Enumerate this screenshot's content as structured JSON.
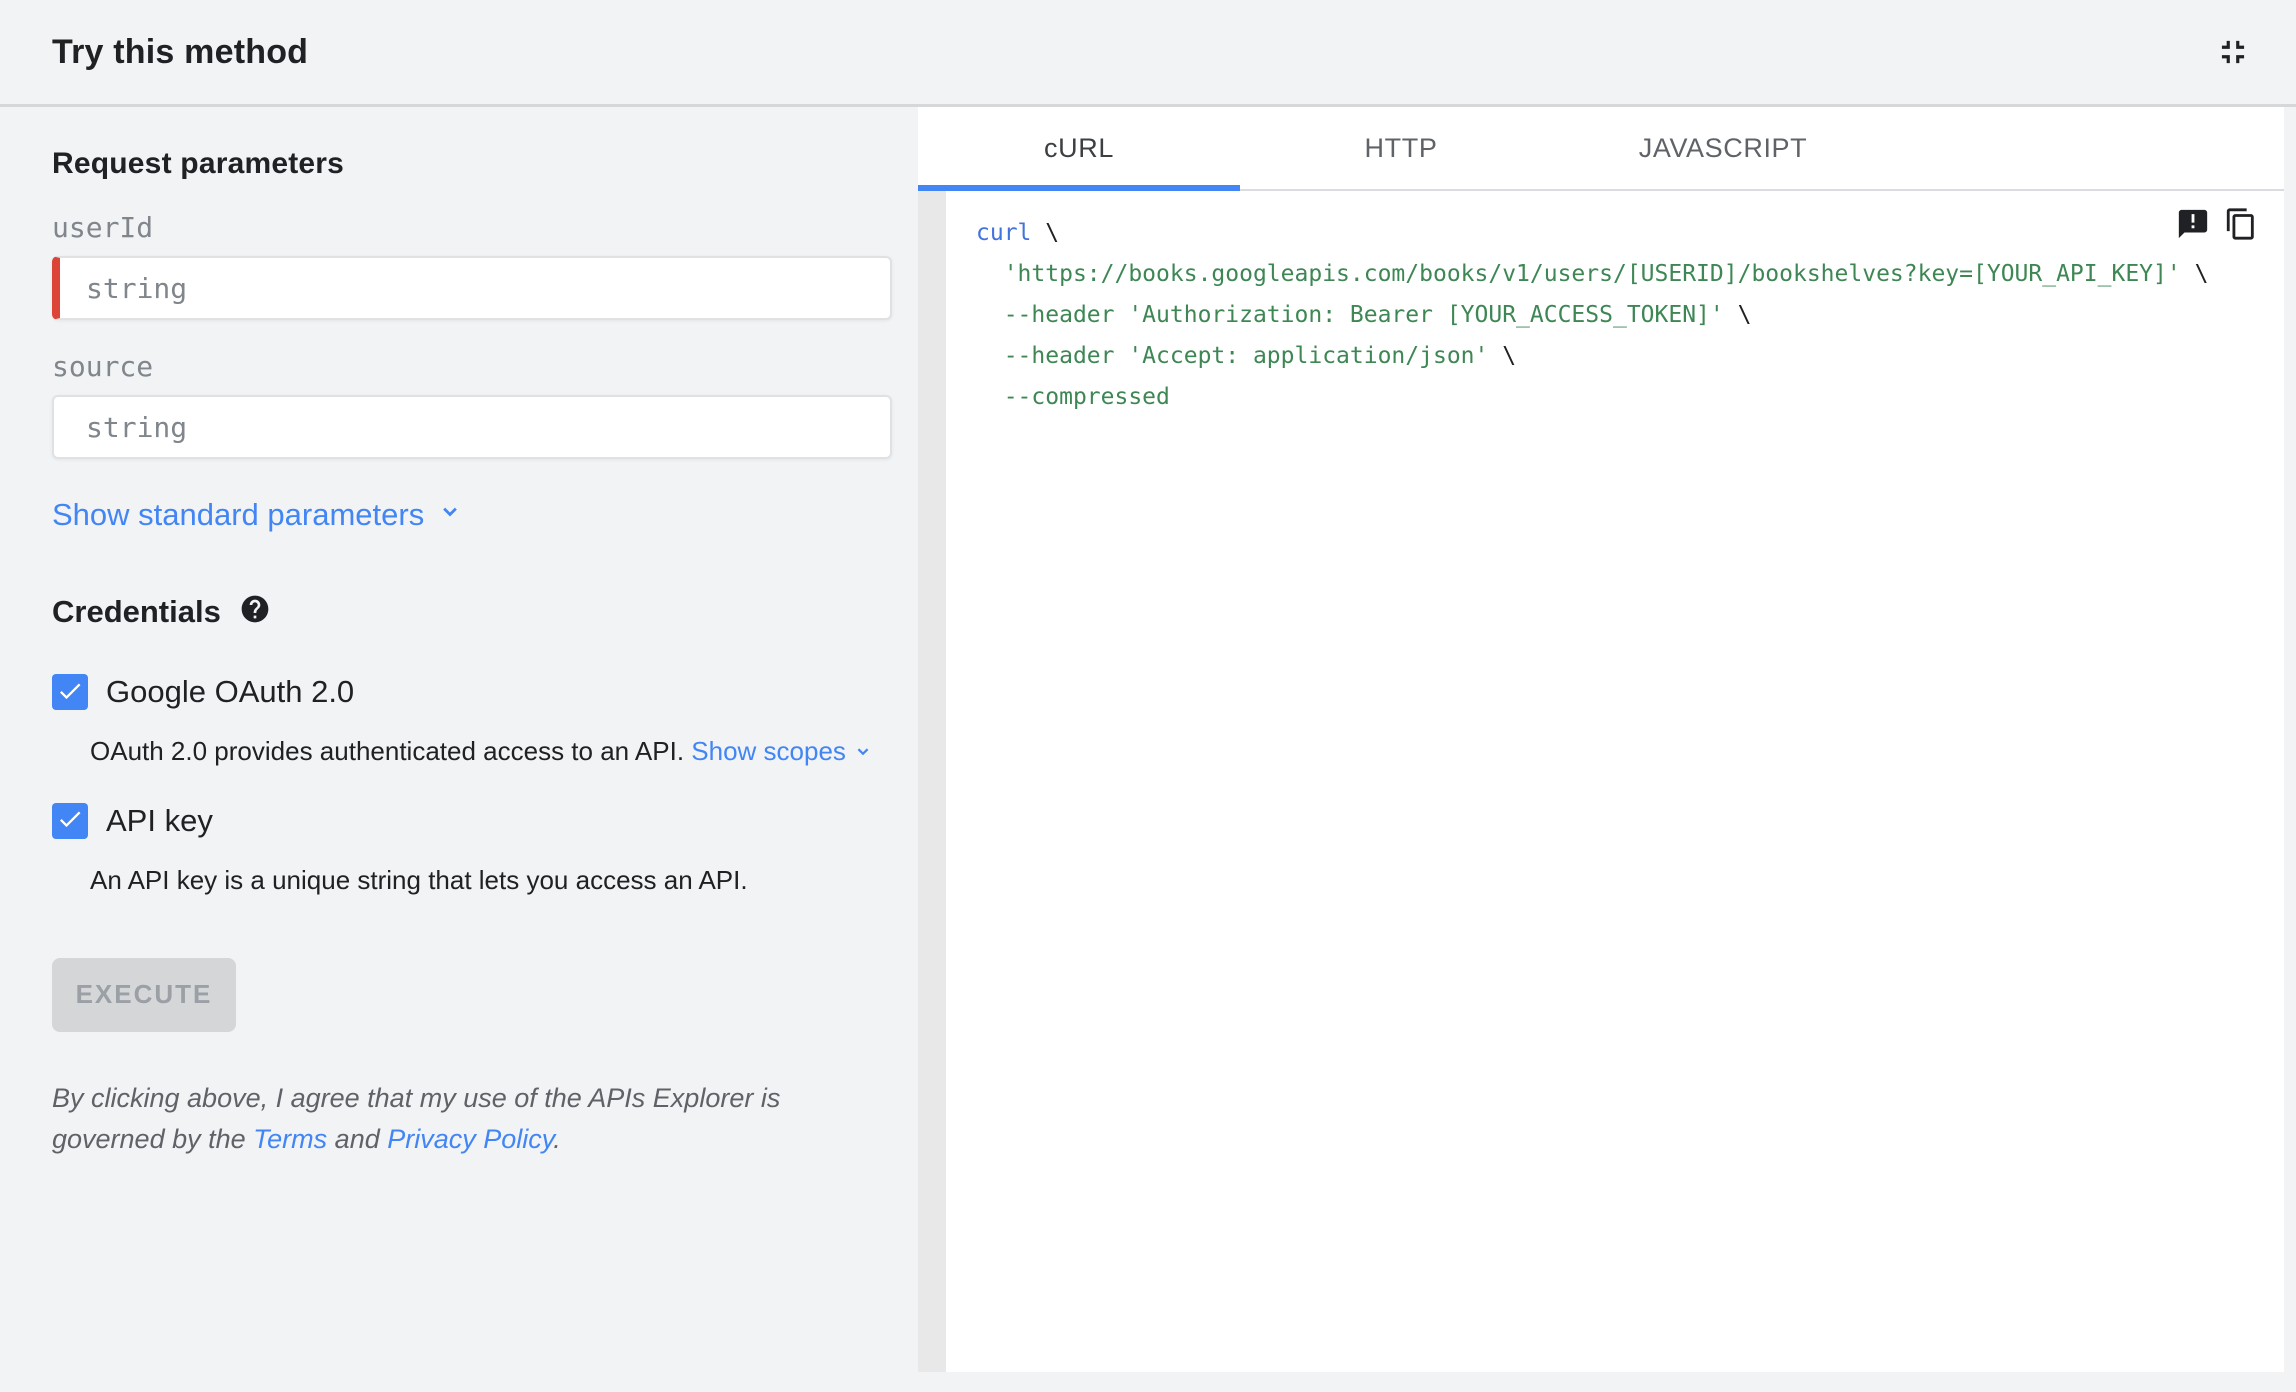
{
  "colors": {
    "page-bg": "#f1f3f4",
    "accent-blue": "#4285f4",
    "required-red": "#db4437",
    "code-keyword": "#4272db",
    "code-string": "#3e8755",
    "code-plain": "#202124"
  },
  "header": {
    "title": "Try this method",
    "collapse_icon": "fullscreen-exit"
  },
  "left_panel": {
    "request_parameters": {
      "heading": "Request parameters",
      "fields": [
        {
          "label": "userId",
          "placeholder": "string",
          "required": true
        },
        {
          "label": "source",
          "placeholder": "string",
          "required": false
        }
      ],
      "show_standard_parameters": "Show standard parameters"
    },
    "credentials": {
      "heading": "Credentials",
      "options": [
        {
          "label": "Google OAuth 2.0",
          "checked": true,
          "description": "OAuth 2.0 provides authenticated access to an API.",
          "link": "Show scopes"
        },
        {
          "label": "API key",
          "checked": true,
          "description": "An API key is a unique string that lets you access an API.",
          "link": ""
        }
      ]
    },
    "execute_button": "EXECUTE",
    "legal": {
      "text_before": "By clicking above, I agree that my use of the APIs Explorer is governed by the ",
      "terms": "Terms",
      "text_middle": " and ",
      "privacy": "Privacy Policy",
      "text_after": "."
    }
  },
  "code_panel": {
    "tabs": [
      {
        "label": "cURL",
        "active": true
      },
      {
        "label": "HTTP",
        "active": false
      },
      {
        "label": "JAVASCRIPT",
        "active": false
      }
    ],
    "code_lines": [
      [
        {
          "text": "curl",
          "cls": "kwd"
        },
        {
          "text": " \\",
          "cls": "pln"
        }
      ],
      [
        {
          "text": "  ",
          "cls": "pln"
        },
        {
          "text": "'https://books.googleapis.com/books/v1/users/[USERID]/bookshelves?key=[YOUR_API_KEY]'",
          "cls": "str"
        },
        {
          "text": " \\",
          "cls": "pln"
        }
      ],
      [
        {
          "text": "  ",
          "cls": "pln"
        },
        {
          "text": "--header 'Authorization: Bearer [YOUR_ACCESS_TOKEN]'",
          "cls": "str"
        },
        {
          "text": " \\",
          "cls": "pln"
        }
      ],
      [
        {
          "text": "  ",
          "cls": "pln"
        },
        {
          "text": "--header 'Accept: application/json'",
          "cls": "str"
        },
        {
          "text": " \\",
          "cls": "pln"
        }
      ],
      [
        {
          "text": "  ",
          "cls": "pln"
        },
        {
          "text": "--compressed",
          "cls": "str"
        }
      ]
    ]
  }
}
